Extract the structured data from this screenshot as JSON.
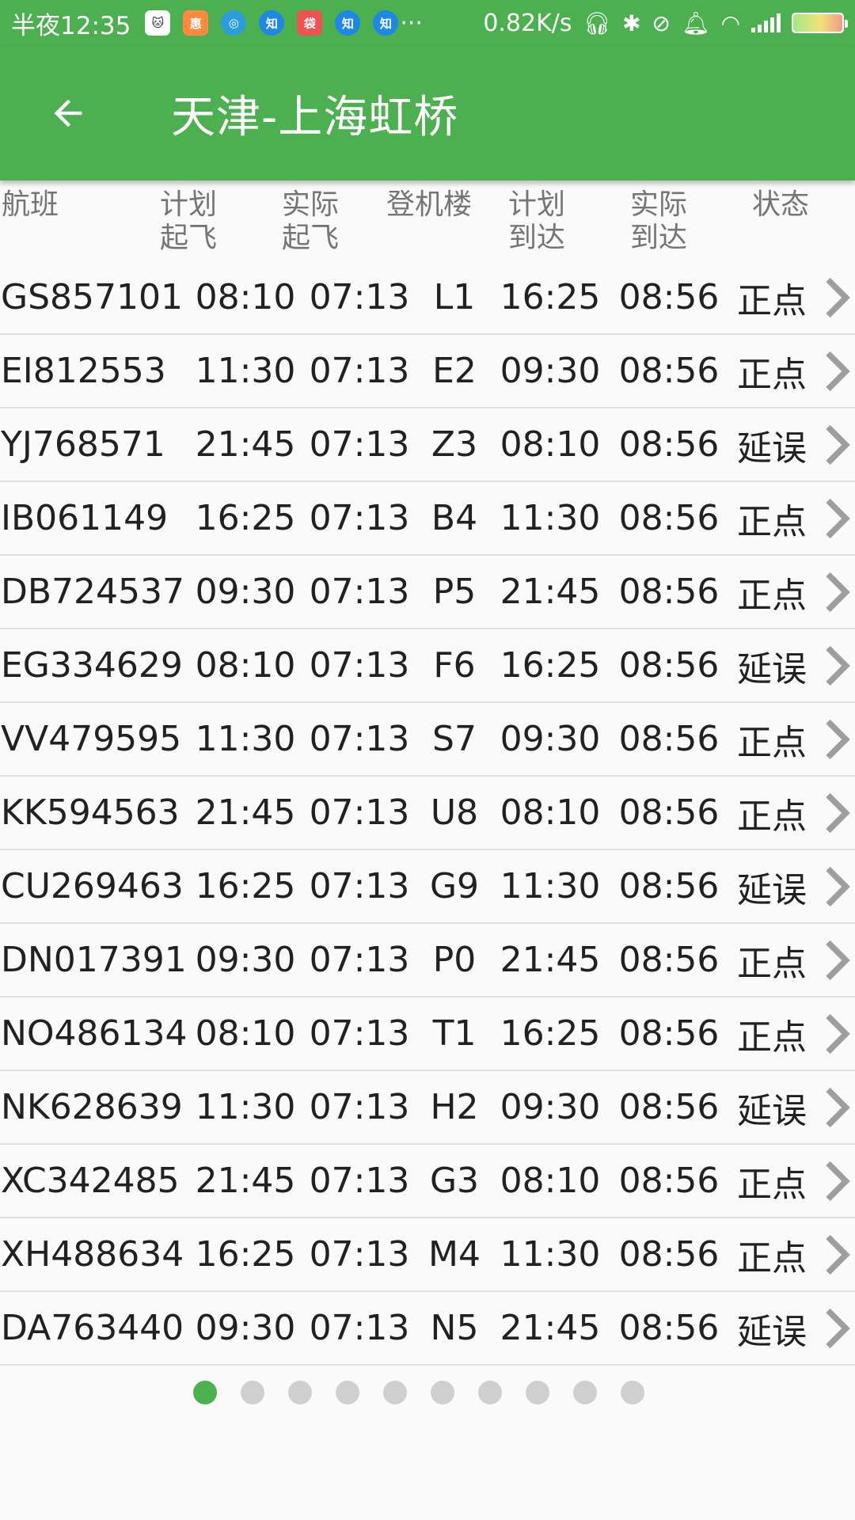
{
  "status_bar": {
    "time": "半夜12:35",
    "notification_icons": [
      {
        "name": "cat-app-icon",
        "color": "#ffffff",
        "text": "🐱"
      },
      {
        "name": "discount-app-icon",
        "color": "#ff8a3d",
        "text": "惠"
      },
      {
        "name": "qq-browser-icon",
        "color": "#2d9cdb",
        "text": "◎"
      },
      {
        "name": "zhihu-icon",
        "color": "#1e88e5",
        "text": "知"
      },
      {
        "name": "shopping-app-icon",
        "color": "#ef5350",
        "text": "袋"
      },
      {
        "name": "zhihu-icon",
        "color": "#1e88e5",
        "text": "知"
      },
      {
        "name": "zhihu-icon",
        "color": "#1e88e5",
        "text": "知"
      }
    ],
    "more": "···",
    "net_speed": "0.82K/s"
  },
  "app_bar": {
    "title": "天津-上海虹桥"
  },
  "table": {
    "headers": [
      "航班",
      "计划起飞",
      "实际起飞",
      "登机楼",
      "计划到达",
      "实际到达",
      "状态"
    ],
    "rows": [
      [
        "GS857101",
        "08:10",
        "07:13",
        "L1",
        "16:25",
        "08:56",
        "正点"
      ],
      [
        "EI812553",
        "11:30",
        "07:13",
        "E2",
        "09:30",
        "08:56",
        "正点"
      ],
      [
        "YJ768571",
        "21:45",
        "07:13",
        "Z3",
        "08:10",
        "08:56",
        "延误"
      ],
      [
        "IB061149",
        "16:25",
        "07:13",
        "B4",
        "11:30",
        "08:56",
        "正点"
      ],
      [
        "DB724537",
        "09:30",
        "07:13",
        "P5",
        "21:45",
        "08:56",
        "正点"
      ],
      [
        "EG334629",
        "08:10",
        "07:13",
        "F6",
        "16:25",
        "08:56",
        "延误"
      ],
      [
        "VV479595",
        "11:30",
        "07:13",
        "S7",
        "09:30",
        "08:56",
        "正点"
      ],
      [
        "KK594563",
        "21:45",
        "07:13",
        "U8",
        "08:10",
        "08:56",
        "正点"
      ],
      [
        "CU269463",
        "16:25",
        "07:13",
        "G9",
        "11:30",
        "08:56",
        "延误"
      ],
      [
        "DN017391",
        "09:30",
        "07:13",
        "P0",
        "21:45",
        "08:56",
        "正点"
      ],
      [
        "NO486134",
        "08:10",
        "07:13",
        "T1",
        "16:25",
        "08:56",
        "正点"
      ],
      [
        "NK628639",
        "11:30",
        "07:13",
        "H2",
        "09:30",
        "08:56",
        "延误"
      ],
      [
        "XC342485",
        "21:45",
        "07:13",
        "G3",
        "08:10",
        "08:56",
        "正点"
      ],
      [
        "XH488634",
        "16:25",
        "07:13",
        "M4",
        "11:30",
        "08:56",
        "正点"
      ],
      [
        "DA763440",
        "09:30",
        "07:13",
        "N5",
        "21:45",
        "08:56",
        "延误"
      ]
    ]
  },
  "pager": {
    "page_count": 10,
    "active_index": 0
  },
  "colors": {
    "accent": "#4caf50",
    "dot_inactive": "#cfcfcf",
    "divider": "#e0e0e0"
  }
}
